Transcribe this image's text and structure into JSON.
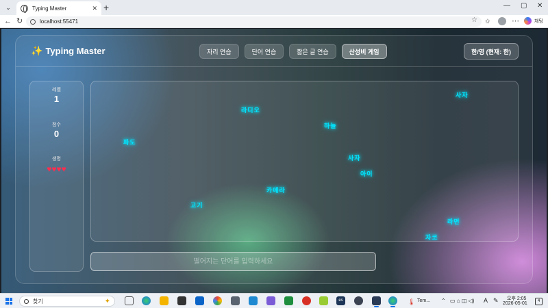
{
  "browser": {
    "tab_title": "Typing Master",
    "tab_close": "✕",
    "new_tab": "+",
    "url": "localhost:55471",
    "copilot_label": "채팅",
    "win_min": "—",
    "win_max": "▢",
    "win_close": "✕"
  },
  "app": {
    "logo_icon": "✨",
    "title": "Typing Master",
    "nav": [
      {
        "label": "자리 연습",
        "active": false
      },
      {
        "label": "단어 연습",
        "active": false
      },
      {
        "label": "짧은 글 연습",
        "active": false
      },
      {
        "label": "산성비 게임",
        "active": true
      }
    ],
    "lang_button": "한/영 (현재: 한)"
  },
  "stats": {
    "level_label": "레벨",
    "level_value": "1",
    "score_label": "점수",
    "score_value": "0",
    "life_label": "생명",
    "hearts": "♥♥♥♥",
    "life_count": 4
  },
  "game": {
    "words": [
      "사자",
      "라디오",
      "하늘",
      "파도",
      "사자",
      "아이",
      "카메라",
      "고기",
      "라면",
      "자코"
    ],
    "input_placeholder": "떨어지는 단어를 입력하세요",
    "word_color": "#00e5ff"
  },
  "taskbar": {
    "search_placeholder": "찾기",
    "weather_label": "Tem...",
    "time": "오후 2:05",
    "date": "2026-05-01",
    "ime": "A",
    "notif_count": "4"
  }
}
